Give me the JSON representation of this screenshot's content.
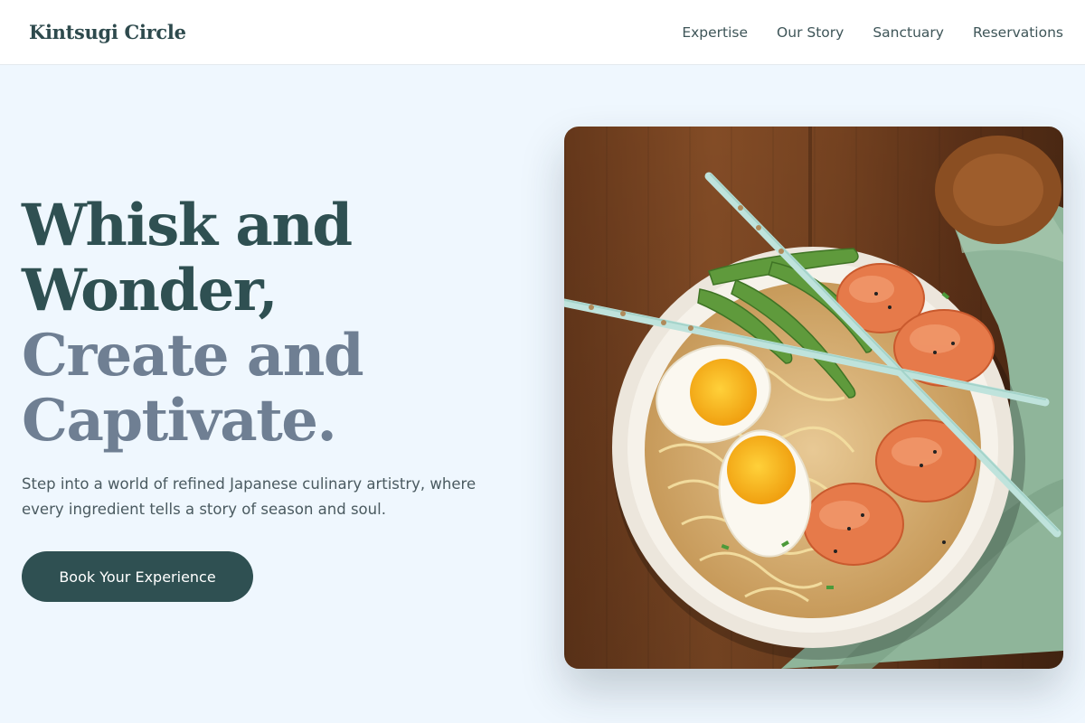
{
  "nav": {
    "brand": "Kintsugi Circle",
    "links": [
      {
        "label": "Expertise"
      },
      {
        "label": "Our Story"
      },
      {
        "label": "Sanctuary"
      },
      {
        "label": "Reservations"
      }
    ]
  },
  "hero": {
    "headline_lines": [
      {
        "text": "Whisk and",
        "tone": "dark"
      },
      {
        "text": "Wonder,",
        "tone": "dark"
      },
      {
        "text": "Create and",
        "tone": "muted"
      },
      {
        "text": "Captivate.",
        "tone": "muted"
      }
    ],
    "subtitle": "Step into a world of refined Japanese culinary artistry, where every ingredient tells a story of season and soul.",
    "cta_label": "Book Your Experience"
  },
  "colors": {
    "accent": "#2f5052",
    "muted_heading": "#6f7f93",
    "page_background": "#eff7fe"
  }
}
